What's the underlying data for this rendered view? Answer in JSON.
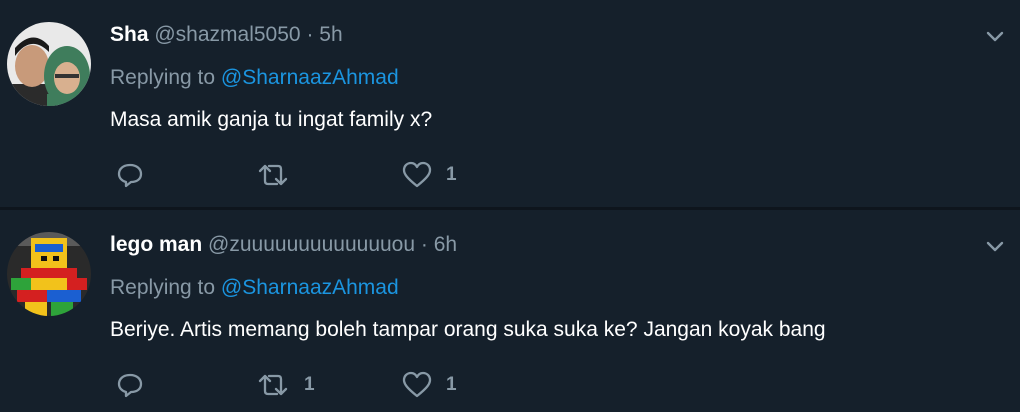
{
  "tweets": [
    {
      "name": "Sha",
      "handle": "@shazmal5050",
      "separator": "·",
      "time": "5h",
      "replying_label": "Replying to",
      "replying_to": "@SharnaazAhmad",
      "text": "Masa amik ganja tu ingat family x?",
      "reply_count": "",
      "retweet_count": "",
      "like_count": "1"
    },
    {
      "name": "lego man",
      "handle": "@zuuuuuuuuuuuuuou",
      "separator": "·",
      "time": "6h",
      "replying_label": "Replying to",
      "replying_to": "@SharnaazAhmad",
      "text": "Beriye. Artis memang boleh tampar orang suka suka ke? Jangan koyak bang",
      "reply_count": "",
      "retweet_count": "1",
      "like_count": "1"
    }
  ],
  "colors": {
    "background": "#15202b",
    "secondary_text": "#8899a6",
    "link": "#1b95e0"
  },
  "icons": [
    "reply-icon",
    "retweet-icon",
    "like-icon",
    "chevron-down-icon"
  ]
}
